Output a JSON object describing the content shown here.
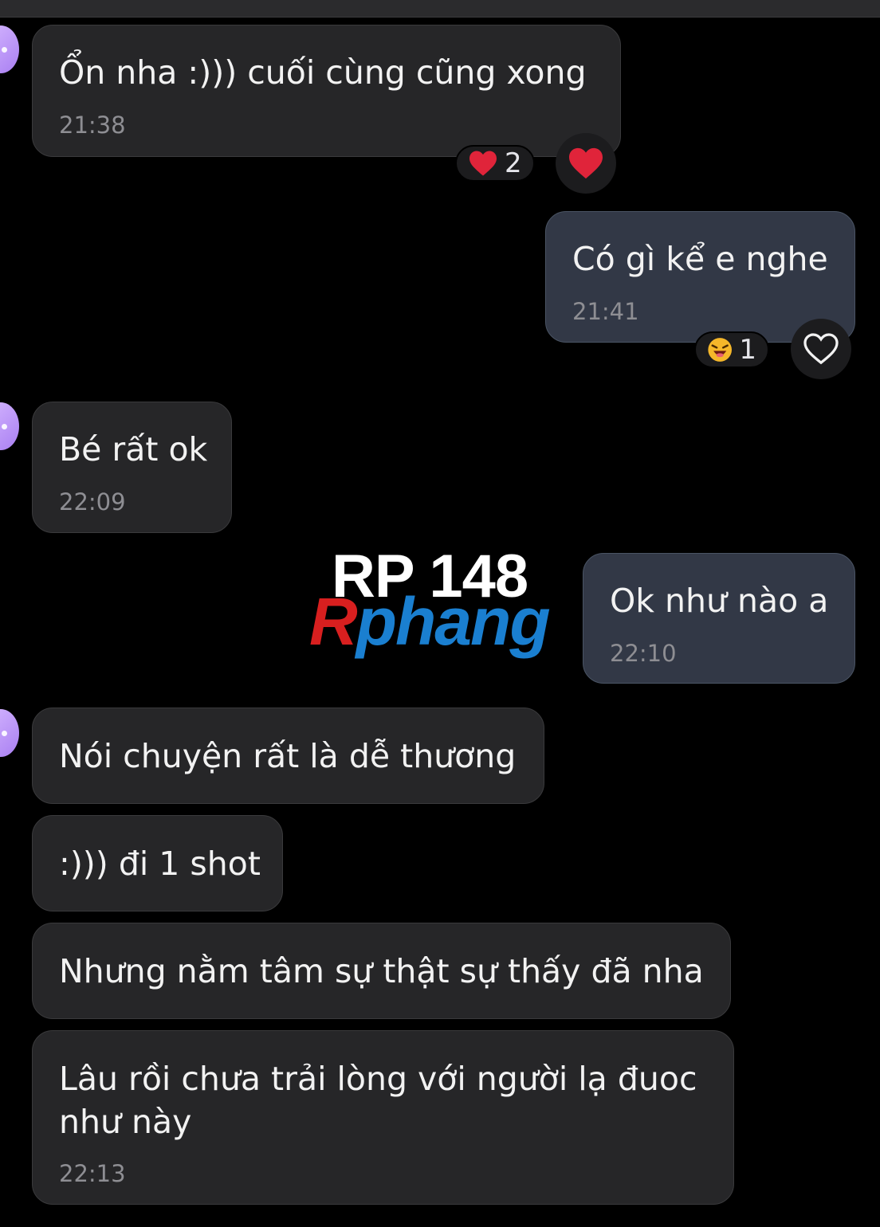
{
  "messages": [
    {
      "text": "Ổn nha :))) cuối cùng cũng xong",
      "time": "21:38",
      "reaction_count": "2"
    },
    {
      "text": "Có gì kể e nghe",
      "time": "21:41",
      "reaction_count": "1"
    },
    {
      "text": "Bé rất ok",
      "time": "22:09"
    },
    {
      "text": "Ok như nào a",
      "time": "22:10"
    },
    {
      "text": "Nói chuyện rất là dễ thương"
    },
    {
      "text": ":))) đi 1 shot"
    },
    {
      "text": "Nhưng nằm tâm sự thật sự thấy đã nha"
    },
    {
      "text_line1": "Lâu rồi chưa trải lòng với người lạ đuoc",
      "text_line2": "như này",
      "time": "22:13"
    }
  ],
  "watermark": {
    "top": "RP 148",
    "bottom_r": "R",
    "bottom_rest": "phang"
  },
  "colors": {
    "background": "#000000",
    "incoming_bubble": "#262628",
    "outgoing_bubble": "#323846",
    "heart": "#e0243a"
  },
  "icons": {
    "reaction_heart": "heart-icon",
    "reaction_laugh": "laughing-emoji-icon",
    "add_reaction": "heart-outline-icon"
  }
}
